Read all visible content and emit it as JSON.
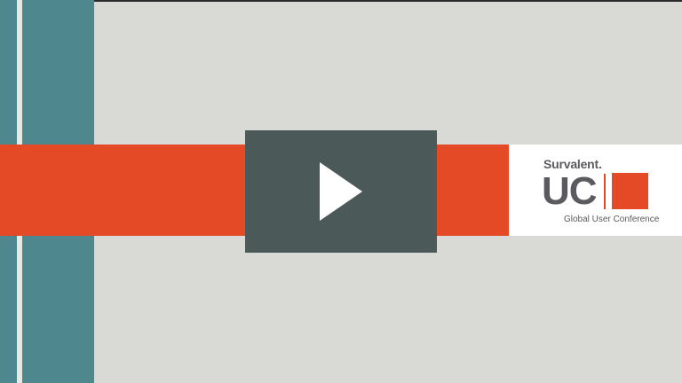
{
  "logo": {
    "brand": "Survalent.",
    "mark": "UC",
    "tagline": "Global User Conference"
  },
  "player": {
    "play_icon": "play-icon",
    "play_button_label": ""
  },
  "colors": {
    "background": "#d9dad6",
    "teal": "#4f878e",
    "accent_orange": "#e44a26",
    "overlay": "#4b5a58",
    "logo_text": "#5b5b5f"
  }
}
